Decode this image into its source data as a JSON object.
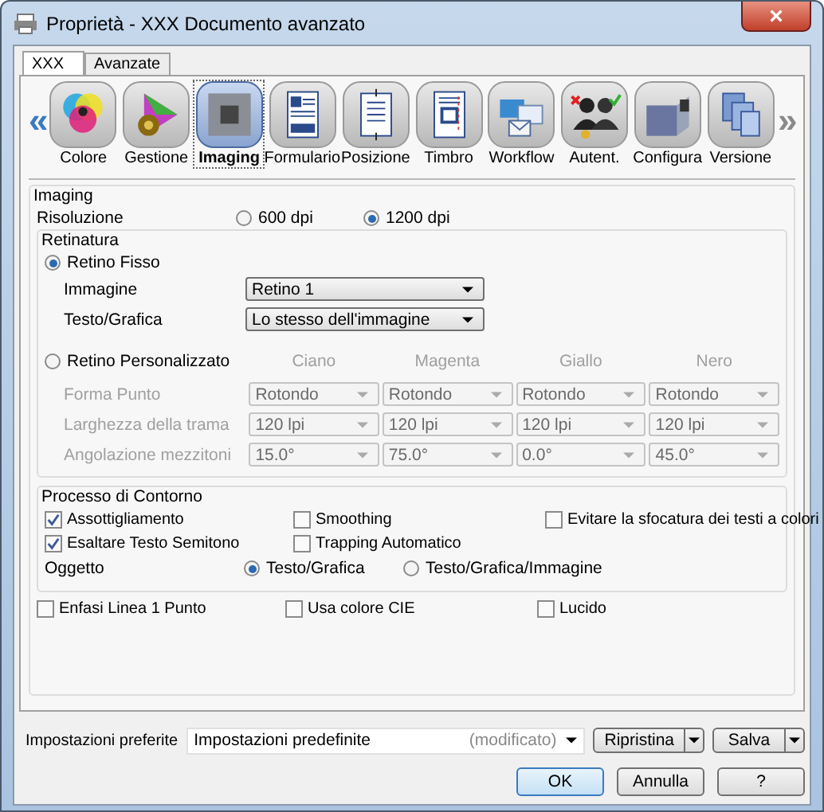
{
  "window": {
    "title": "Proprietà - XXX Documento avanzato",
    "close": "×"
  },
  "tabs": [
    {
      "label": "XXX",
      "selected": true
    },
    {
      "label": "Avanzate",
      "selected": false
    }
  ],
  "toolbar": {
    "prev": "«",
    "next": "»",
    "items": [
      {
        "label": "Colore",
        "selected": false
      },
      {
        "label": "Gestione",
        "selected": false
      },
      {
        "label": "Imaging",
        "selected": true
      },
      {
        "label": "Formulario",
        "selected": false
      },
      {
        "label": "Posizione",
        "selected": false
      },
      {
        "label": "Timbro",
        "selected": false
      },
      {
        "label": "Workflow",
        "selected": false
      },
      {
        "label": "Autent.",
        "selected": false
      },
      {
        "label": "Configura",
        "selected": false
      },
      {
        "label": "Versione",
        "selected": false
      }
    ]
  },
  "imaging": {
    "title": "Imaging",
    "resolution": {
      "label": "Risoluzione",
      "options": [
        {
          "label": "600 dpi",
          "selected": false
        },
        {
          "label": "1200 dpi",
          "selected": true
        }
      ]
    }
  },
  "screening": {
    "title": "Retinatura",
    "fixed": {
      "label": "Retino Fisso",
      "selected": true,
      "fields": [
        {
          "label": "Immagine",
          "value": "Retino 1"
        },
        {
          "label": "Testo/Grafica",
          "value": "Lo stesso dell'immagine"
        }
      ]
    },
    "custom": {
      "label": "Retino Personalizzato",
      "selected": false,
      "disabled": true,
      "columns": [
        "Ciano",
        "Magenta",
        "Giallo",
        "Nero"
      ],
      "rows": [
        {
          "label": "Forma Punto",
          "values": [
            "Rotondo",
            "Rotondo",
            "Rotondo",
            "Rotondo"
          ]
        },
        {
          "label": "Larghezza della trama",
          "values": [
            "120 lpi",
            "120 lpi",
            "120 lpi",
            "120 lpi"
          ]
        },
        {
          "label": "Angolazione mezzitoni",
          "values": [
            "15.0°",
            "75.0°",
            "0.0°",
            "45.0°"
          ]
        }
      ]
    }
  },
  "edge": {
    "title": "Processo di Contorno",
    "checkboxes": [
      {
        "label": "Assottigliamento",
        "checked": true
      },
      {
        "label": "Smoothing",
        "checked": false
      },
      {
        "label": "Evitare la sfocatura dei testi a colori",
        "checked": false
      },
      {
        "label": "Esaltare Testo Semitono",
        "checked": true
      },
      {
        "label": "Trapping Automatico",
        "checked": false
      }
    ],
    "object": {
      "label": "Oggetto",
      "options": [
        {
          "label": "Testo/Grafica",
          "selected": true
        },
        {
          "label": "Testo/Grafica/Immagine",
          "selected": false
        }
      ]
    }
  },
  "options": [
    {
      "label": "Enfasi Linea 1 Punto",
      "checked": false
    },
    {
      "label": "Usa colore CIE",
      "checked": false
    },
    {
      "label": "Lucido",
      "checked": false
    }
  ],
  "favorites": {
    "label": "Impostazioni preferite",
    "value": "Impostazioni predefinite",
    "note": "(modificato)",
    "buttons": [
      "Ripristina",
      "Salva"
    ]
  },
  "buttons": [
    "OK",
    "Annulla",
    "?"
  ]
}
